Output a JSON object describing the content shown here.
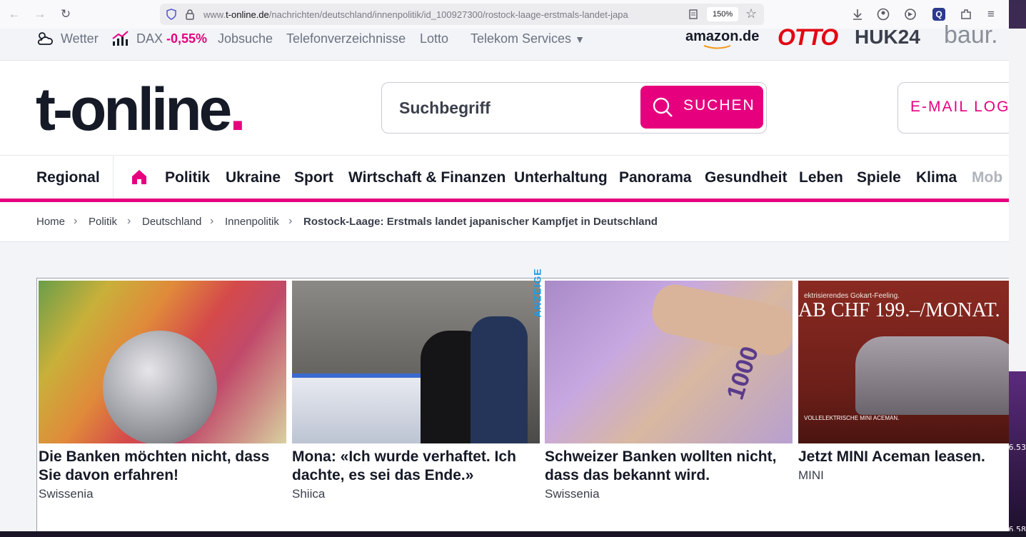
{
  "browser": {
    "url_prefix": "www.",
    "url_domain": "t-online.de",
    "url_path": "/nachrichten/deutschland/innenpolitik/id_100927300/rostock-laage-erstmals-landet-japa",
    "zoom": "150%"
  },
  "topstrip": {
    "wetter": "Wetter",
    "dax_label": "DAX",
    "dax_value": "-0,55%",
    "jobsuche": "Jobsuche",
    "telefon": "Telefonverzeichnisse",
    "lotto": "Lotto",
    "telekom": "Telekom Services",
    "brands": [
      "amazon.de",
      "OTTO",
      "HUK24",
      "baur."
    ]
  },
  "header": {
    "logo_text": "t-online",
    "logo_dot": ".",
    "search_placeholder": "Suchbegriff",
    "search_button": "SUCHEN",
    "mail_button": "E-MAIL LOGI"
  },
  "nav": {
    "items": [
      "Regional",
      "Politik",
      "Ukraine",
      "Sport",
      "Wirtschaft & Finanzen",
      "Unterhaltung",
      "Panorama",
      "Gesundheit",
      "Leben",
      "Spiele",
      "Klima",
      "Mob"
    ]
  },
  "breadcrumb": {
    "items": [
      "Home",
      "Politik",
      "Deutschland",
      "Innenpolitik"
    ],
    "current": "Rostock-Laage: Erstmals landet japanischer Kampfjet in Deutschland"
  },
  "ads": {
    "label": "ANZEIGE",
    "cards": [
      {
        "title": "Die Banken möchten nicht, dass Sie davon erfahren!",
        "source": "Swissenia"
      },
      {
        "title": "Mona: «Ich wurde verhaftet. Ich dachte, es sei das Ende.»",
        "source": "Shiica"
      },
      {
        "title": "Schweizer Banken wollten nicht, dass das bekannt wird.",
        "source": "Swissenia"
      },
      {
        "title": "Jetzt MINI Aceman leasen.",
        "source": "MINI"
      }
    ],
    "img_texts": {
      "mini_headline": "AB CHF 199.–/MONAT.",
      "mini_top": "ektrisierendes Gokart-Feeling.",
      "mini_sub": "VOLLELEKTRISCHE MINI ACEMAN.",
      "banknote": "1000"
    }
  },
  "colors": {
    "accent": "#e6007e",
    "text": "#161a27",
    "anzeige": "#1e9be6"
  },
  "desktop": {
    "clock_a": "6.53",
    "clock_b": "6.58"
  }
}
